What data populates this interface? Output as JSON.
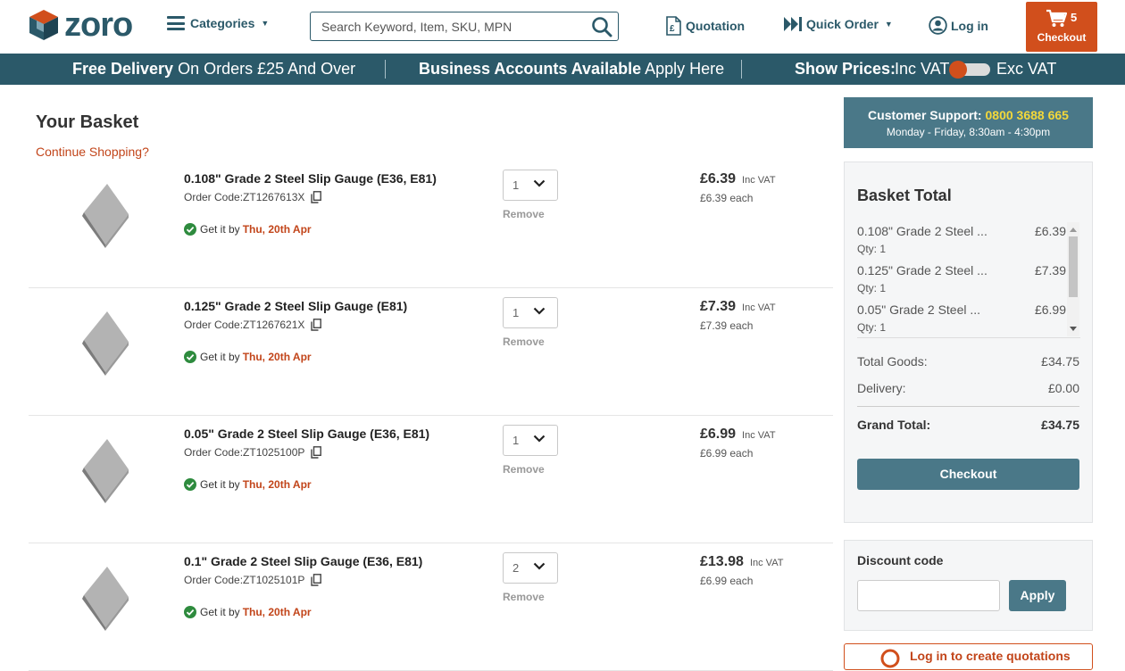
{
  "header": {
    "logo_text": "zoro",
    "categories_label": "Categories",
    "search_placeholder": "Search Keyword, Item, SKU, MPN",
    "search_value": "",
    "quotation_label": "Quotation",
    "quick_order_label": "Quick Order",
    "login_label": "Log in",
    "cart_count": "5",
    "checkout_label": "Checkout"
  },
  "banner": {
    "delivery_bold": "Free Delivery",
    "delivery_rest": " On Orders £25 And Over",
    "business_bold": "Business Accounts Available",
    "business_rest": " Apply Here",
    "prices_bold": "Show Prices:",
    "inc_vat": "Inc VAT",
    "exc_vat": "Exc VAT"
  },
  "basket": {
    "title": "Your Basket",
    "continue_label": "Continue Shopping?",
    "order_code_prefix": "Order Code: ",
    "get_it_by": "Get it by",
    "remove_label": "Remove",
    "inc_vat_label": "Inc VAT",
    "items": [
      {
        "name": "0.108\" Grade 2 Steel Slip Gauge (E36, E81)",
        "code": "ZT1267613X",
        "date": "Thu, 20th Apr",
        "qty": "1",
        "price": "£6.39",
        "each": "£6.39 each"
      },
      {
        "name": "0.125\" Grade 2 Steel Slip Gauge (E81)",
        "code": "ZT1267621X",
        "date": "Thu, 20th Apr",
        "qty": "1",
        "price": "£7.39",
        "each": "£7.39 each"
      },
      {
        "name": "0.05\" Grade 2 Steel Slip Gauge (E36, E81)",
        "code": "ZT1025100P",
        "date": "Thu, 20th Apr",
        "qty": "1",
        "price": "£6.99",
        "each": "£6.99 each"
      },
      {
        "name": "0.1\" Grade 2 Steel Slip Gauge (E36, E81)",
        "code": "ZT1025101P",
        "date": "Thu, 20th Apr",
        "qty": "2",
        "price": "£13.98",
        "each": "£6.99 each"
      }
    ]
  },
  "support": {
    "label": "Customer Support: ",
    "phone": "0800 3688 665",
    "hours": "Monday - Friday, 8:30am - 4:30pm"
  },
  "totals": {
    "title": "Basket Total",
    "mini_items": [
      {
        "name": "0.108\" Grade 2 Steel ...",
        "price": "£6.39",
        "qty": "Qty: 1"
      },
      {
        "name": "0.125\" Grade 2 Steel ...",
        "price": "£7.39",
        "qty": "Qty: 1"
      },
      {
        "name": "0.05\" Grade 2 Steel ...",
        "price": "£6.99",
        "qty": "Qty: 1"
      }
    ],
    "total_goods_label": "Total Goods:",
    "total_goods_value": "£34.75",
    "delivery_label": "Delivery:",
    "delivery_value": "£0.00",
    "grand_total_label": "Grand Total:",
    "grand_total_value": "£34.75",
    "checkout_label": "Checkout"
  },
  "discount": {
    "title": "Discount code",
    "input_value": "",
    "apply_label": "Apply"
  },
  "quotations": {
    "label": "Log in to create quotations"
  },
  "colors": {
    "brand_teal": "#2b5969",
    "accent_orange": "#d14f1c",
    "support_blue": "#4a7888",
    "phone_yellow": "#f3d83a",
    "delivery_green": "#2e8b3e"
  }
}
